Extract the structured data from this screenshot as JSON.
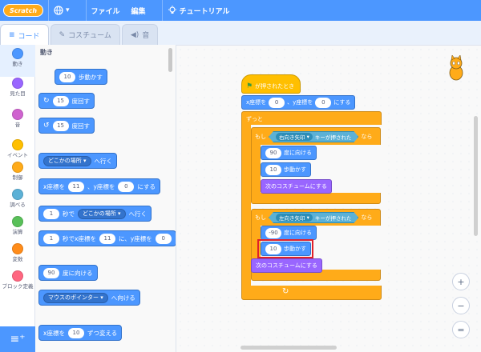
{
  "menubar": {
    "logo": "Scratch",
    "file": "ファイル",
    "edit": "編集",
    "tutorial": "チュートリアル"
  },
  "tabs": {
    "code": "コード",
    "costume": "コスチューム",
    "sound": "音"
  },
  "categories": [
    {
      "label": "動き",
      "color": "#4c97ff"
    },
    {
      "label": "見た目",
      "color": "#9966ff"
    },
    {
      "label": "音",
      "color": "#cf63cf"
    },
    {
      "label": "イベント",
      "color": "#ffbf00"
    },
    {
      "label": "制御",
      "color": "#ffab19"
    },
    {
      "label": "調べる",
      "color": "#5cb1d6"
    },
    {
      "label": "演算",
      "color": "#59c059"
    },
    {
      "label": "変数",
      "color": "#ff8c1a"
    },
    {
      "label": "ブロック定義",
      "color": "#ff6680"
    }
  ],
  "palette": {
    "title": "動き",
    "move": {
      "value": "10",
      "text": "歩動かす"
    },
    "turn_right": {
      "value": "15",
      "text": "度回す"
    },
    "turn_left": {
      "value": "15",
      "text": "度回す"
    },
    "goto": {
      "dropdown": "どこかの場所",
      "text": "へ行く"
    },
    "gotoxy": {
      "x_label": "x座標を",
      "x": "11",
      "y_label": "、y座標を",
      "y": "0",
      "text": "にする"
    },
    "glide": {
      "secs": "1",
      "mid": "秒で",
      "dropdown": "どこかの場所",
      "text": "へ行く"
    },
    "glidexy": {
      "secs": "1",
      "mid": "秒でx座標を",
      "x": "11",
      "y_label": "に、y座標を",
      "y": "0"
    },
    "point": {
      "value": "90",
      "text": "度に向ける"
    },
    "point_towards": {
      "dropdown": "マウスのポインター",
      "text": "へ向ける"
    },
    "changex": {
      "label": "x座標を",
      "value": "10",
      "text": "ずつ変える"
    }
  },
  "script": {
    "hat": "が押されたとき",
    "gotoxy": {
      "x_label": "x座標を",
      "x": "0",
      "y_label": "、y座標を",
      "y": "0",
      "text": "にする"
    },
    "forever": "ずっと",
    "if1": {
      "if": "もし",
      "key": "右向き矢印",
      "cond": "キーが押された",
      "then": "なら"
    },
    "point1": {
      "value": "90",
      "text": "度に向ける"
    },
    "move1": {
      "value": "10",
      "text": "歩動かす"
    },
    "costume1": "次のコスチュームにする",
    "if2": {
      "if": "もし",
      "key": "左向き矢印",
      "cond": "キーが押された",
      "then": "なら"
    },
    "point2": {
      "value": "-90",
      "text": "度に向ける"
    },
    "move2": {
      "value": "10",
      "text": "歩動かす"
    },
    "costume2": "次のコスチュームにする",
    "loop_icon": "↻"
  },
  "zoom": {
    "in": "+",
    "out": "−",
    "reset": "="
  },
  "colors": {
    "menubar": "#4c97ff",
    "motion": "#4c97ff",
    "looks": "#9966ff",
    "control": "#ffab19",
    "events": "#ffbf00",
    "sensing": "#5cb1d6",
    "highlight": "#e0202a"
  },
  "icons": [
    "globe-icon",
    "chevron-down-icon",
    "lightbulb-icon",
    "code-icon",
    "brush-icon",
    "speaker-icon",
    "turn-right-icon",
    "turn-left-icon",
    "green-flag-icon",
    "sprite-cat-icon",
    "zoom-in-icon",
    "zoom-out-icon",
    "zoom-reset-icon",
    "add-extension-icon"
  ]
}
